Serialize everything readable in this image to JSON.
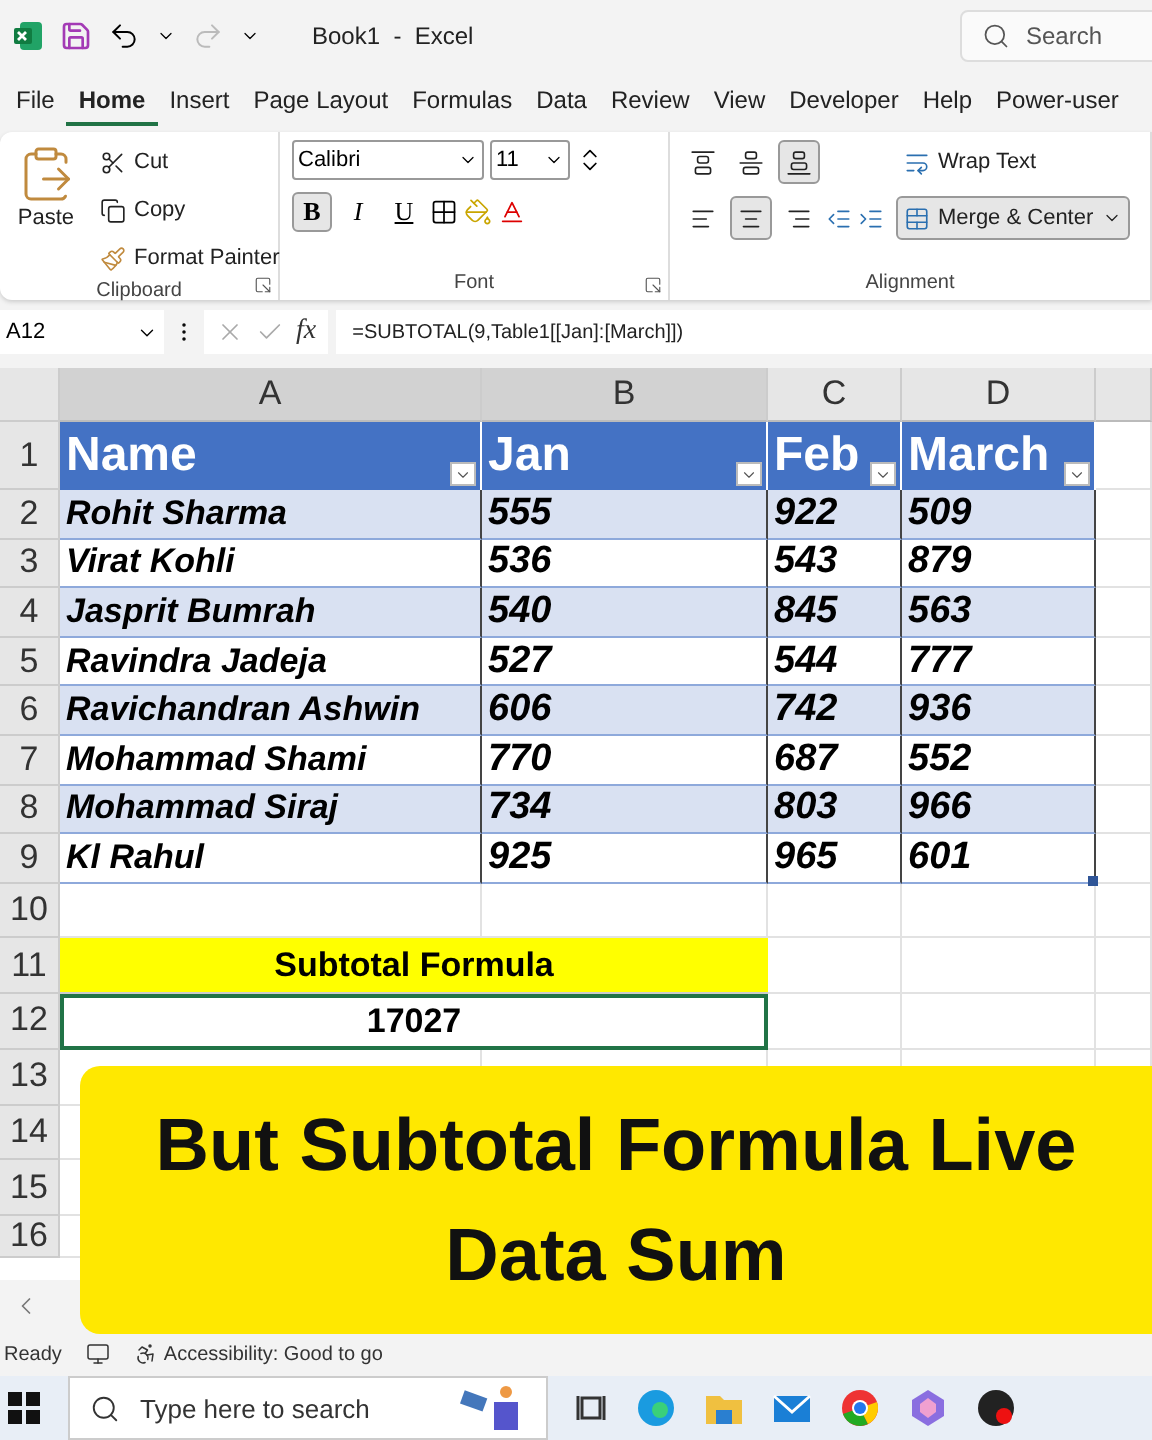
{
  "title_bar": {
    "title": "Book1  -  Excel",
    "search_placeholder": "Search"
  },
  "menu_tabs": [
    {
      "label": "File",
      "selected": false
    },
    {
      "label": "Home",
      "selected": true
    },
    {
      "label": "Insert",
      "selected": false
    },
    {
      "label": "Page Layout",
      "selected": false
    },
    {
      "label": "Formulas",
      "selected": false
    },
    {
      "label": "Data",
      "selected": false
    },
    {
      "label": "Review",
      "selected": false
    },
    {
      "label": "View",
      "selected": false
    },
    {
      "label": "Developer",
      "selected": false
    },
    {
      "label": "Help",
      "selected": false
    },
    {
      "label": "Power-user",
      "selected": false
    }
  ],
  "ribbon": {
    "clipboard": {
      "paste": "Paste",
      "cut": "Cut",
      "copy": "Copy",
      "format_painter": "Format Painter",
      "label": "Clipboard"
    },
    "font": {
      "font_name": "Calibri",
      "font_size": "11",
      "label": "Font",
      "styles": [
        {
          "kind": "bold",
          "text": "B",
          "selected": true
        },
        {
          "kind": "italic",
          "text": "I",
          "selected": false
        },
        {
          "kind": "underline",
          "text": "U",
          "selected": false
        }
      ]
    },
    "alignment": {
      "label": "Alignment",
      "wrap_text": "Wrap Text",
      "merge_center": "Merge & Center",
      "vertical": [
        {
          "kind": "top",
          "selected": false
        },
        {
          "kind": "middle",
          "selected": false
        },
        {
          "kind": "bottom",
          "selected": true
        }
      ],
      "horizontal": [
        {
          "kind": "left",
          "selected": false
        },
        {
          "kind": "center",
          "selected": true
        },
        {
          "kind": "right",
          "selected": false
        }
      ]
    }
  },
  "formula_bar": {
    "name_box": "A12",
    "fx": "fx",
    "formula": "=SUBTOTAL(9,Table1[[Jan]:[March]])"
  },
  "sheet": {
    "columns": [
      "A",
      "B",
      "C",
      "D"
    ],
    "row_numbers": [
      "1",
      "2",
      "3",
      "4",
      "5",
      "6",
      "7",
      "8",
      "9",
      "10",
      "11",
      "12",
      "13",
      "14",
      "15",
      "16"
    ],
    "table": {
      "headers": [
        "Name",
        "Jan",
        "Feb",
        "March"
      ],
      "rows": [
        [
          "Rohit Sharma",
          "555",
          "922",
          "509"
        ],
        [
          "Virat Kohli",
          "536",
          "543",
          "879"
        ],
        [
          "Jasprit Bumrah",
          "540",
          "845",
          "563"
        ],
        [
          "Ravindra Jadeja",
          "527",
          "544",
          "777"
        ],
        [
          "Ravichandran Ashwin",
          "606",
          "742",
          "936"
        ],
        [
          "Mohammad Shami",
          "770",
          "687",
          "552"
        ],
        [
          "Mohammad Siraj",
          "734",
          "803",
          "966"
        ],
        [
          "Kl Rahul",
          "925",
          "965",
          "601"
        ]
      ]
    },
    "subtotal": {
      "label": "Subtotal Formula",
      "value": "17027"
    }
  },
  "banner": {
    "lines": [
      "But Subtotal Formula Live",
      "Data Sum"
    ]
  },
  "status_bar": {
    "ready": "Ready",
    "accessibility": "Accessibility: Good to go"
  },
  "taskbar": {
    "search_placeholder": "Type here to search"
  }
}
